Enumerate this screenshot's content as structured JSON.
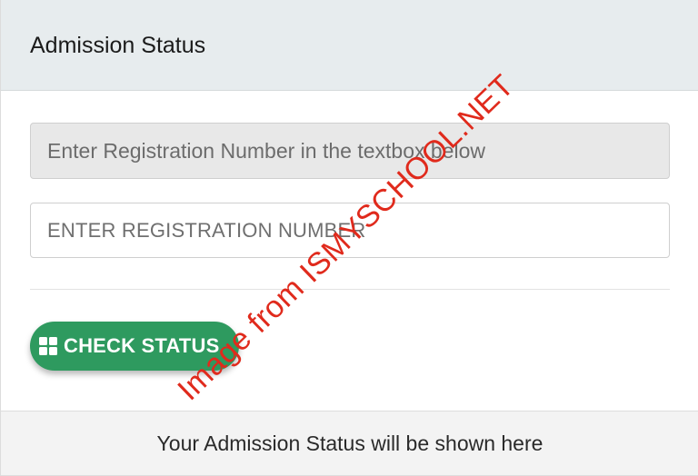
{
  "header": {
    "title": "Admission Status"
  },
  "form": {
    "info_text": "Enter Registration Number in the textbox below",
    "reg_placeholder": "ENTER REGISTRATION NUMBER",
    "check_button_label": "CHECK STATUS"
  },
  "result": {
    "status_text": "Your Admission Status will be shown here"
  },
  "watermark": {
    "text": "Image from ISMYSCHOOL.NET"
  },
  "colors": {
    "button": "#2e9a5f",
    "header_bg": "#e7ecee",
    "watermark": "#e02a1c"
  }
}
